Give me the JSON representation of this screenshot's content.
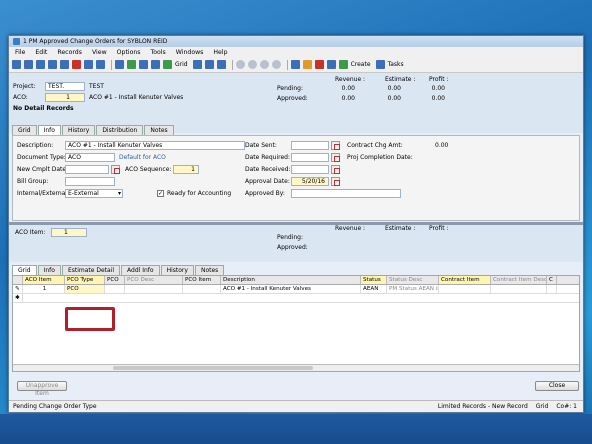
{
  "window": {
    "title": "1 PM Approved Change Orders for SYBLON REID"
  },
  "menu": [
    "File",
    "Edit",
    "Records",
    "View",
    "Options",
    "Tools",
    "Windows",
    "Help"
  ],
  "toolbar": {
    "grid_label": "Grid",
    "create_label": "Create",
    "tasks_label": "Tasks"
  },
  "header": {
    "project_label": "Project:",
    "project_value": "TEST.",
    "project_desc": "TEST",
    "aco_label": "ACO:",
    "aco_value": "1",
    "aco_desc": "ACO #1 - Install Kenuter Valves",
    "no_detail": "No Detail Records",
    "revenue_label": "Revenue :",
    "estimate_label": "Estimate :",
    "profit_label": "Profit :",
    "pending_label": "Pending:",
    "approved_label": "Approved:",
    "pending_values": [
      "0.00",
      "0.00",
      "0.00"
    ],
    "approved_values": [
      "0.00",
      "0.00",
      "0.00"
    ]
  },
  "tabs_top": [
    "Grid",
    "Info",
    "History",
    "Distribution",
    "Notes"
  ],
  "info": {
    "description_label": "Description:",
    "description_value": "ACO #1 - Install Kenuter Valves",
    "doctype_label": "Document Type:",
    "doctype_value": "ACO",
    "doctype_hint": "Default for ACO",
    "new_cmplt_label": "New Cmplt Date:",
    "aco_seq_label": "ACO Sequence:",
    "aco_seq_value": "1",
    "bill_group_label": "Bill Group:",
    "internal_label": "Internal/External:",
    "internal_value": "E-External",
    "ready_label": "Ready for Accounting",
    "date_sent_label": "Date Sent:",
    "date_required_label": "Date Required:",
    "date_received_label": "Date Received:",
    "approval_date_label": "Approval Date:",
    "approval_date_value": "5/20/16",
    "approved_by_label": "Approved By:",
    "contract_chg_label": "Contract Chg Amt:",
    "contract_chg_value": "0.00",
    "proj_completion_label": "Proj Completion Date:"
  },
  "lower": {
    "aco_item_label": "ACO Item:",
    "aco_item_value": "1",
    "revenue_label": "Revenue :",
    "estimate_label": "Estimate :",
    "profit_label": "Profit :",
    "pending_label": "Pending:",
    "approved_label": "Approved:"
  },
  "tabs_lower": [
    "Grid",
    "Info",
    "Estimate Detail",
    "Addl Info",
    "History",
    "Notes"
  ],
  "grid": {
    "columns": [
      "ACO Item",
      "PCO Type",
      "PCO",
      "PCO Desc",
      "PCO Item",
      "Description",
      "Status",
      "Status Desc",
      "Contract Item",
      "Contract Item Desc",
      "C"
    ],
    "row": [
      "1",
      "PCO",
      "",
      "",
      "",
      "ACO #1 - Install Kenuter Valves",
      "AEAN",
      "PM Status AEAN is",
      "",
      "",
      ""
    ]
  },
  "buttons": {
    "unapprove": "Unapprove Item",
    "close": "Close"
  },
  "status": {
    "left": "Pending Change Order Type",
    "limited": "Limited Records - New Record",
    "grid": "Grid",
    "co": "Co#: 1"
  }
}
